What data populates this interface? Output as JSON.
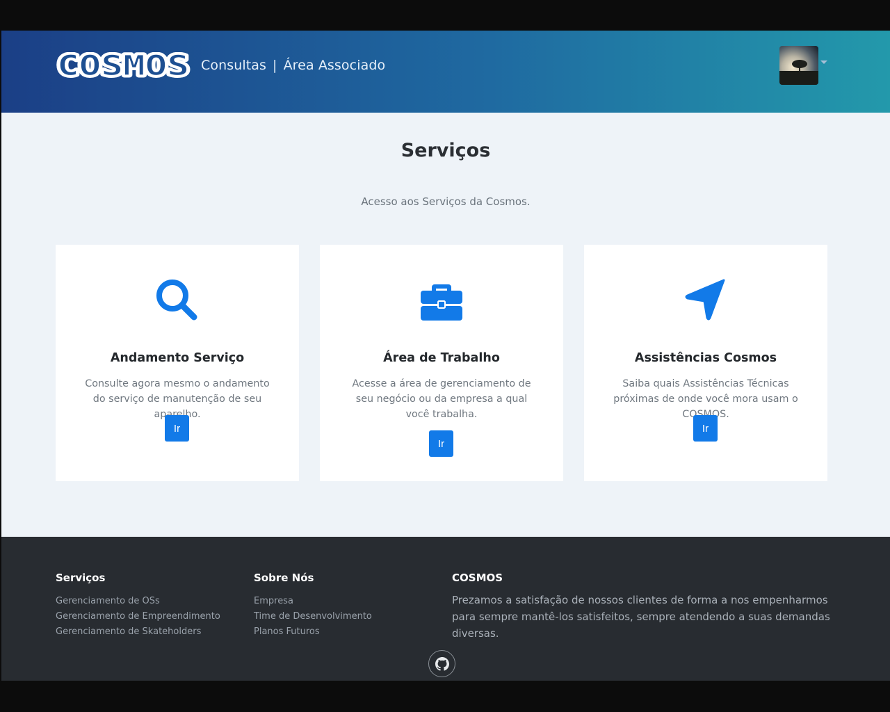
{
  "header": {
    "logo_text": "COSMOS",
    "nav": [
      {
        "label": "Consultas"
      },
      {
        "label": "Área Associado"
      }
    ],
    "separator": "|"
  },
  "main": {
    "title": "Serviços",
    "subtitle": "Acesso aos Serviços da Cosmos.",
    "cards": [
      {
        "icon": "search-icon",
        "title": "Andamento Serviço",
        "text": "Consulte agora mesmo o andamento do serviço de manutenção de seu aparelho.",
        "button": "Ir"
      },
      {
        "icon": "briefcase-icon",
        "title": "Área de Trabalho",
        "text": "Acesse a área de gerenciamento de seu negócio ou da empresa a qual você trabalha.",
        "button": "Ir"
      },
      {
        "icon": "location-arrow-icon",
        "title": "Assistências Cosmos",
        "text": "Saiba quais Assistências Técnicas próximas de onde você mora usam o COSMOS.",
        "button": "Ir"
      }
    ]
  },
  "footer": {
    "col1": {
      "title": "Serviços",
      "items": [
        "Gerenciamento de OSs",
        "Gerenciamento de Empreendimento",
        "Gerenciamento de Skateholders"
      ]
    },
    "col2": {
      "title": "Sobre Nós",
      "items": [
        "Empresa",
        "Time de Desenvolvimento",
        "Planos Futuros"
      ]
    },
    "col3": {
      "title": "COSMOS",
      "text": "Prezamos a satisfação de nossos clientes de forma a nos empenharmos para sempre mantê-los satisfeitos, sempre atendendo a suas demandas diversas."
    },
    "social_icon": "github-icon"
  },
  "colors": {
    "accent": "#127ae8",
    "header_start": "#1b3f86",
    "header_end": "#2399ab",
    "footer_bg": "#282c31",
    "page_bg": "#eef3f8"
  }
}
